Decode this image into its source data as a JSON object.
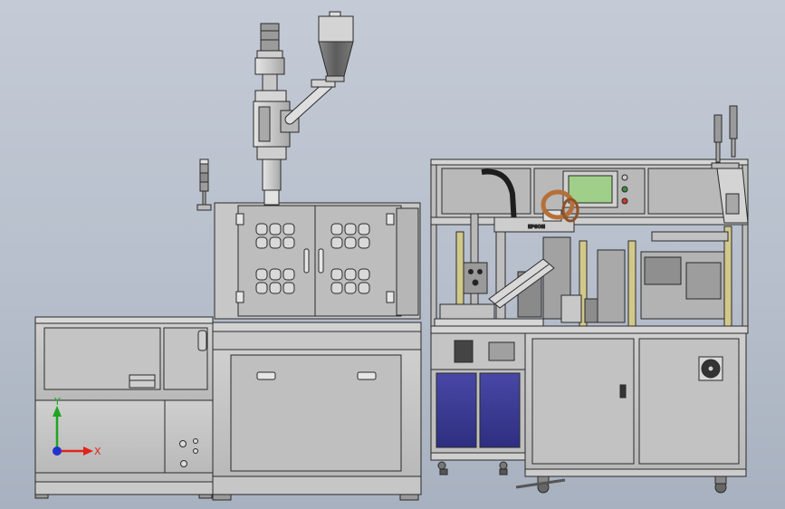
{
  "view": {
    "type": "cad-assembly-front-view",
    "background": "#b9c1cd"
  },
  "triad": {
    "x_label": "X",
    "y_label": "Y",
    "x_color": "#e0241c",
    "y_color": "#1fa51f",
    "z_color": "#2233cc"
  },
  "labels": {
    "robot_brand": "EPSON"
  },
  "colors": {
    "frame_gray": "#c9c9c9",
    "outline": "#2a2a2a",
    "hmi_screen": "#9fcf88",
    "cabinet_blue": "#3a3a92",
    "hopper_dark": "#6d6d6d",
    "cable_orange": "#b5703a",
    "signal_green": "#3b8f3b",
    "signal_red": "#c93b2b"
  }
}
